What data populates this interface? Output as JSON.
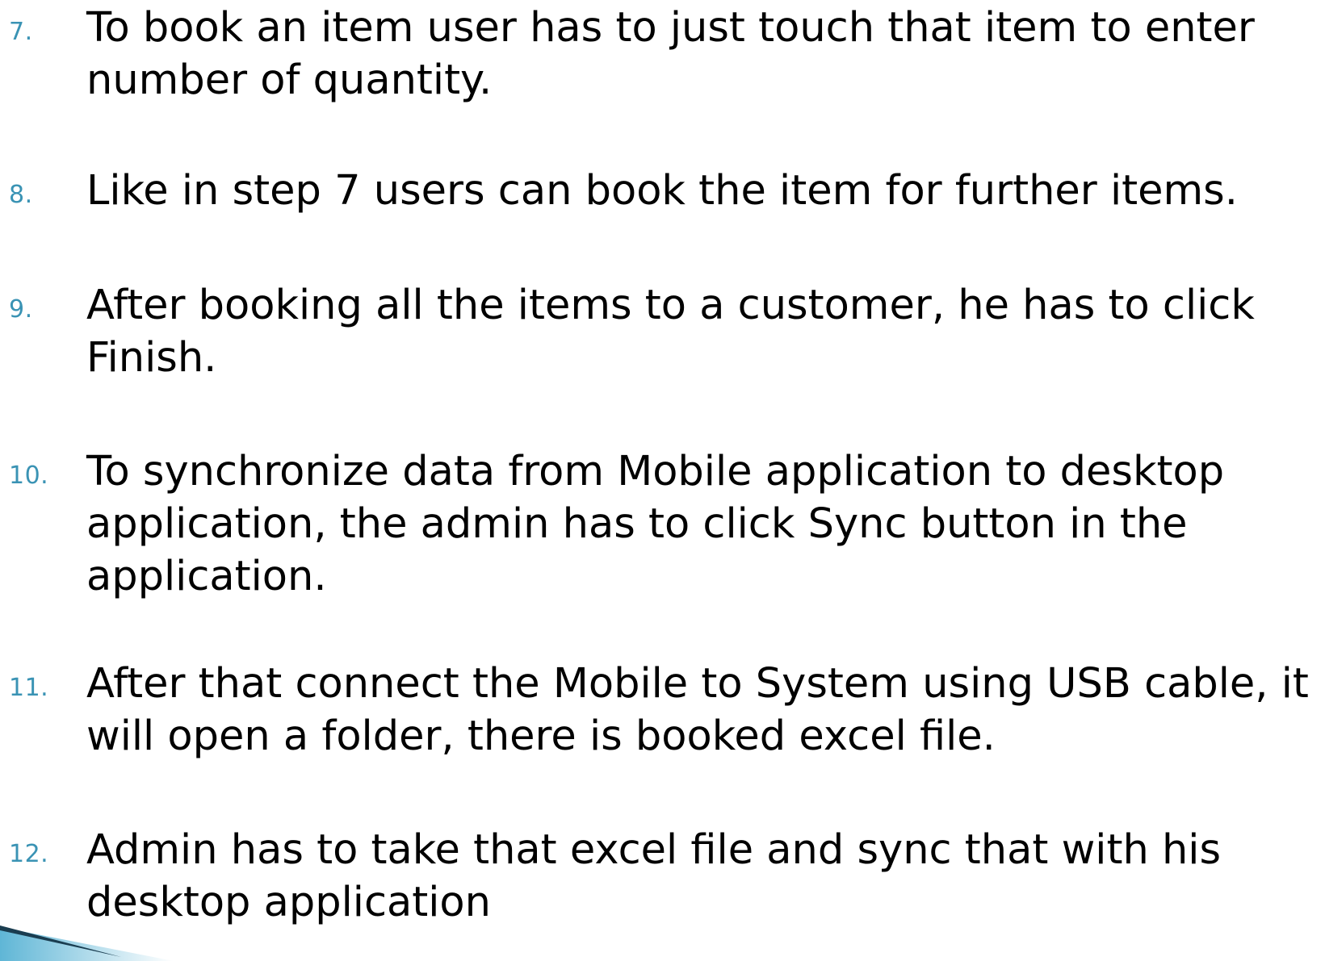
{
  "list": {
    "items": [
      {
        "number": "7.",
        "lines": [
          "To book an item user has to just touch that item to enter",
          "number of quantity."
        ]
      },
      {
        "number": "8.",
        "lines": [
          "Like in step 7 users can book the item for further items."
        ]
      },
      {
        "number": "9.",
        "lines": [
          "After booking all the items to a customer, he has to click",
          "Finish."
        ]
      },
      {
        "number": "10.",
        "lines": [
          "To synchronize data from Mobile application to desktop",
          "application, the admin has to click Sync button in the",
          "application."
        ]
      },
      {
        "number": "11.",
        "lines": [
          "After that connect the Mobile to System using USB cable, it",
          "will open a folder, there is booked excel file."
        ]
      },
      {
        "number": "12.",
        "lines": [
          "Admin has to take that excel file and sync that with his",
          "desktop application"
        ]
      }
    ]
  },
  "colors": {
    "bullet_number": "#3a93b4",
    "body_text": "#000000",
    "accent_dark": "#1a3d50",
    "accent_light": "#5fb6d6"
  },
  "decoration": {
    "corner_icon": "slide-corner-swoosh"
  }
}
